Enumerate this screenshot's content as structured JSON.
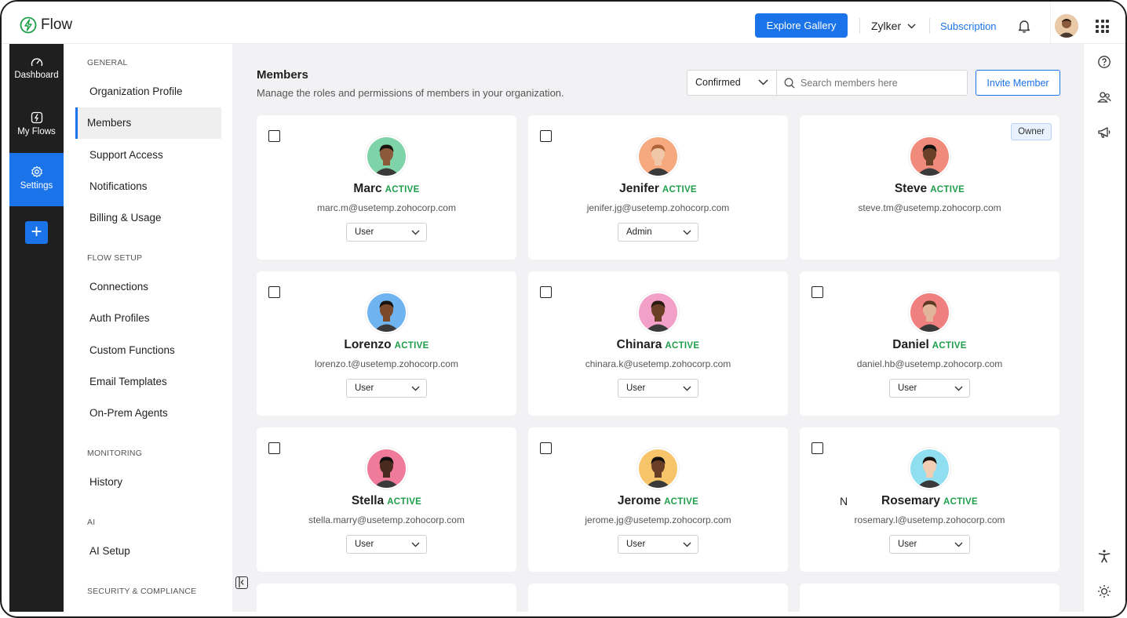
{
  "app": {
    "name": "Flow"
  },
  "header": {
    "explore_label": "Explore Gallery",
    "org_name": "Zylker",
    "subscription_label": "Subscription"
  },
  "rail": {
    "items": [
      {
        "label": "Dashboard",
        "icon": "gauge-icon"
      },
      {
        "label": "My Flows",
        "icon": "flow-icon"
      },
      {
        "label": "Settings",
        "icon": "gear-icon"
      }
    ],
    "add_label": "+"
  },
  "settings_nav": {
    "sections": [
      {
        "title": "GENERAL",
        "items": [
          "Organization Profile",
          "Members",
          "Support Access",
          "Notifications",
          "Billing & Usage"
        ]
      },
      {
        "title": "FLOW SETUP",
        "items": [
          "Connections",
          "Auth Profiles",
          "Custom Functions",
          "Email Templates",
          "On-Prem Agents"
        ]
      },
      {
        "title": "MONITORING",
        "items": [
          "History"
        ]
      },
      {
        "title": "AI",
        "items": [
          "AI Setup"
        ]
      },
      {
        "title": "SECURITY & COMPLIANCE",
        "items": []
      }
    ],
    "active": "Members"
  },
  "main": {
    "title": "Members",
    "subtitle": "Manage the roles and permissions of members in your organization.",
    "filter_value": "Confirmed",
    "search_placeholder": "Search members here",
    "invite_label": "Invite Member",
    "stray_char": "N",
    "members": [
      {
        "name": "Marc",
        "status": "ACTIVE",
        "email": "marc.m@usetemp.zohocorp.com",
        "role": "User",
        "bg": "#7fd3a8"
      },
      {
        "name": "Jenifer",
        "status": "ACTIVE",
        "email": "jenifer.jg@usetemp.zohocorp.com",
        "role": "Admin",
        "bg": "#f6a97e"
      },
      {
        "name": "Steve",
        "status": "ACTIVE",
        "email": "steve.tm@usetemp.zohocorp.com",
        "role": "",
        "badge": "Owner",
        "bg": "#f08a7a"
      },
      {
        "name": "Lorenzo",
        "status": "ACTIVE",
        "email": "lorenzo.t@usetemp.zohocorp.com",
        "role": "User",
        "bg": "#6fb4f0"
      },
      {
        "name": "Chinara",
        "status": "ACTIVE",
        "email": "chinara.k@usetemp.zohocorp.com",
        "role": "User",
        "bg": "#f2a0c8"
      },
      {
        "name": "Daniel",
        "status": "ACTIVE",
        "email": "daniel.hb@usetemp.zohocorp.com",
        "role": "User",
        "bg": "#f08080"
      },
      {
        "name": "Stella",
        "status": "ACTIVE",
        "email": "stella.marry@usetemp.zohocorp.com",
        "role": "User",
        "bg": "#f07a9a"
      },
      {
        "name": "Jerome",
        "status": "ACTIVE",
        "email": "jerome.jg@usetemp.zohocorp.com",
        "role": "User",
        "bg": "#f7c46a"
      },
      {
        "name": "Rosemary",
        "status": "ACTIVE",
        "email": "rosemary.l@usetemp.zohocorp.com",
        "role": "User",
        "bg": "#8fdff0"
      }
    ]
  },
  "right_rail": {
    "icons": [
      "help-icon",
      "people-icon",
      "megaphone-icon",
      "accessibility-icon",
      "sun-icon"
    ]
  },
  "colors": {
    "accent": "#1a73e8",
    "rail_bg": "#1f1f1f",
    "active_status": "#1e9e4a",
    "main_bg": "#f2f2f4"
  }
}
